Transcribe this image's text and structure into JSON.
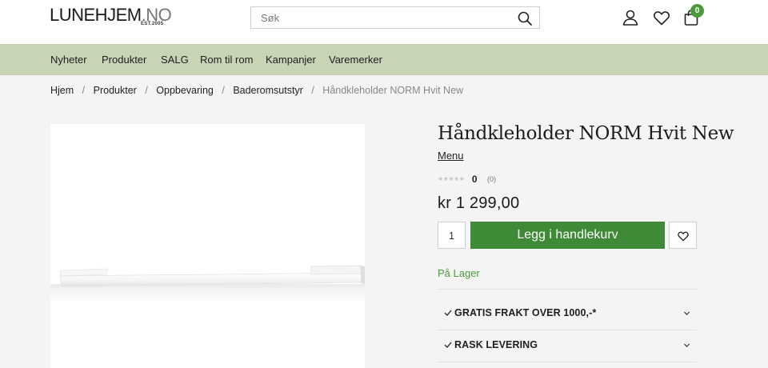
{
  "header": {
    "logo_text": "LUNEHJEM",
    "logo_suffix": ".NO",
    "logo_sub": "EST.2005",
    "search_placeholder": "Søk",
    "cart_count": "0",
    "icons": [
      "search-icon",
      "account-icon",
      "heart-icon",
      "shopping-bag-icon"
    ]
  },
  "nav": {
    "items": [
      {
        "label": "Nyheter"
      },
      {
        "label": "Produkter"
      },
      {
        "label": "SALG"
      },
      {
        "label": "Rom til rom"
      },
      {
        "label": "Kampanjer"
      },
      {
        "label": "Varemerker"
      }
    ]
  },
  "breadcrumb": {
    "items": [
      {
        "label": "Hjem"
      },
      {
        "label": "Produkter"
      },
      {
        "label": "Oppbevaring"
      },
      {
        "label": "Baderomsutstyr"
      }
    ],
    "separator": "/",
    "current": "Håndkleholder NORM Hvit New"
  },
  "product": {
    "title": "Håndkleholder NORM Hvit New",
    "brand_link": "Menu",
    "stars": "★★★★★",
    "rating_value": "0",
    "rating_count": "(0)",
    "price": "kr 1 299,00",
    "quantity": "1",
    "add_to_cart_label": "Legg i handlekurv",
    "stock_status": "På Lager",
    "accordion": [
      {
        "label": "GRATIS FRAKT OVER 1000,-*"
      },
      {
        "label": "RASK LEVERING"
      }
    ]
  },
  "colors": {
    "nav_background": "#c7d5b6",
    "accent_green": "#3f8a37",
    "stock_green": "#4c9a3c",
    "page_background": "#f5f4f4"
  }
}
